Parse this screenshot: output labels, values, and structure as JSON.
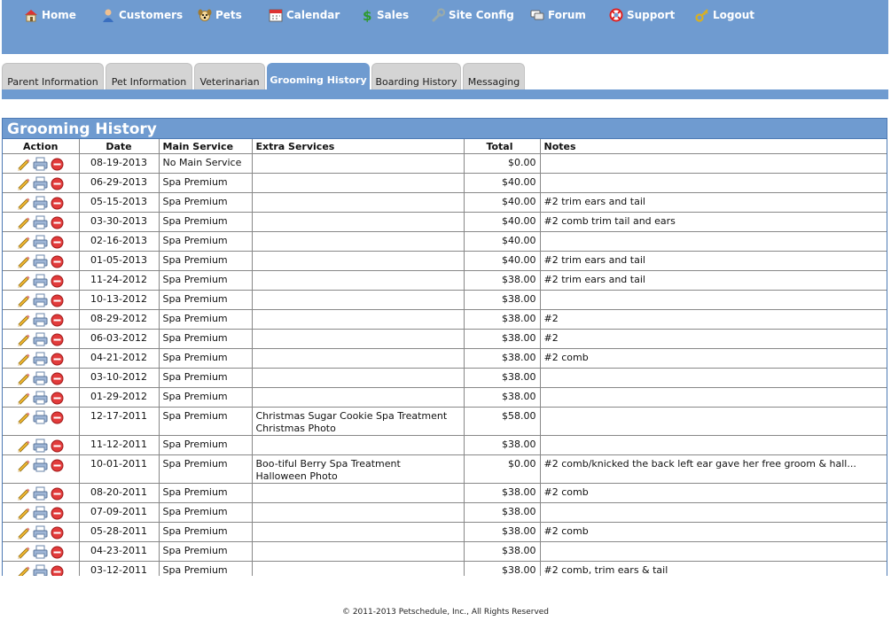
{
  "colors": {
    "brand_blue": "#6f9bd0",
    "tab_gray": "#d4d4d4",
    "panel_border": "#4d7ab5"
  },
  "nav": [
    {
      "label": "Home",
      "icon": "home-icon"
    },
    {
      "label": "Customers",
      "icon": "person-icon"
    },
    {
      "label": "Pets",
      "icon": "dog-icon"
    },
    {
      "label": "Calendar",
      "icon": "calendar-icon"
    },
    {
      "label": "Sales",
      "icon": "dollar-icon"
    },
    {
      "label": "Site Config",
      "icon": "wrench-icon"
    },
    {
      "label": "Forum",
      "icon": "chat-icon"
    },
    {
      "label": "Support",
      "icon": "lifebuoy-icon"
    },
    {
      "label": "Logout",
      "icon": "key-icon"
    }
  ],
  "tabs": [
    {
      "label": "Parent Information",
      "active": false
    },
    {
      "label": "Pet Information",
      "active": false
    },
    {
      "label": "Veterinarian",
      "active": false
    },
    {
      "label": "Grooming History",
      "active": true
    },
    {
      "label": "Boarding History",
      "active": false
    },
    {
      "label": "Messaging",
      "active": false
    }
  ],
  "panel": {
    "title": "Grooming History",
    "columns": [
      "Action",
      "Date",
      "Main Service",
      "Extra Services",
      "Total",
      "Notes"
    ],
    "row_action_icons": [
      "pencil-icon",
      "printer-icon",
      "delete-icon"
    ],
    "rows": [
      {
        "date": "08-19-2013",
        "main": "No Main Service",
        "extra": [
          "",
          ""
        ],
        "total": "$0.00",
        "notes": ""
      },
      {
        "date": "06-29-2013",
        "main": "Spa Premium",
        "extra": [
          "",
          ""
        ],
        "total": "$40.00",
        "notes": ""
      },
      {
        "date": "05-15-2013",
        "main": "Spa Premium",
        "extra": [
          "",
          ""
        ],
        "total": "$40.00",
        "notes": "#2 trim ears and tail"
      },
      {
        "date": "03-30-2013",
        "main": "Spa Premium",
        "extra": [
          "",
          ""
        ],
        "total": "$40.00",
        "notes": "#2 comb trim tail and ears"
      },
      {
        "date": "02-16-2013",
        "main": "Spa Premium",
        "extra": [
          "",
          ""
        ],
        "total": "$40.00",
        "notes": ""
      },
      {
        "date": "01-05-2013",
        "main": "Spa Premium",
        "extra": [
          "",
          ""
        ],
        "total": "$40.00",
        "notes": "#2 trim ears and tail"
      },
      {
        "date": "11-24-2012",
        "main": "Spa Premium",
        "extra": [
          "",
          ""
        ],
        "total": "$38.00",
        "notes": "#2 trim ears and tail"
      },
      {
        "date": "10-13-2012",
        "main": "Spa Premium",
        "extra": [
          "",
          ""
        ],
        "total": "$38.00",
        "notes": ""
      },
      {
        "date": "08-29-2012",
        "main": "Spa Premium",
        "extra": [
          "",
          ""
        ],
        "total": "$38.00",
        "notes": "#2"
      },
      {
        "date": "06-03-2012",
        "main": "Spa Premium",
        "extra": [
          "",
          ""
        ],
        "total": "$38.00",
        "notes": "#2"
      },
      {
        "date": "04-21-2012",
        "main": "Spa Premium",
        "extra": [
          "",
          ""
        ],
        "total": "$38.00",
        "notes": "#2 comb"
      },
      {
        "date": "03-10-2012",
        "main": "Spa Premium",
        "extra": [
          "",
          ""
        ],
        "total": "$38.00",
        "notes": ""
      },
      {
        "date": "01-29-2012",
        "main": "Spa Premium",
        "extra": [
          "",
          ""
        ],
        "total": "$38.00",
        "notes": ""
      },
      {
        "date": "12-17-2011",
        "main": "Spa Premium",
        "extra": [
          "Christmas Sugar Cookie Spa Treatment",
          "Christmas Photo"
        ],
        "total": "$58.00",
        "notes": ""
      },
      {
        "date": "11-12-2011",
        "main": "Spa Premium",
        "extra": [
          "",
          ""
        ],
        "total": "$38.00",
        "notes": ""
      },
      {
        "date": "10-01-2011",
        "main": "Spa Premium",
        "extra": [
          "Boo-tiful Berry Spa Treatment",
          "Halloween Photo"
        ],
        "total": "$0.00",
        "notes": "#2 comb/knicked the back left ear gave her free groom & hall..."
      },
      {
        "date": "08-20-2011",
        "main": "Spa Premium",
        "extra": [
          "",
          ""
        ],
        "total": "$38.00",
        "notes": "#2 comb"
      },
      {
        "date": "07-09-2011",
        "main": "Spa Premium",
        "extra": [
          "",
          ""
        ],
        "total": "$38.00",
        "notes": ""
      },
      {
        "date": "05-28-2011",
        "main": "Spa Premium",
        "extra": [
          "",
          ""
        ],
        "total": "$38.00",
        "notes": "#2 comb"
      },
      {
        "date": "04-23-2011",
        "main": "Spa Premium",
        "extra": [
          "",
          ""
        ],
        "total": "$38.00",
        "notes": ""
      },
      {
        "date": "03-12-2011",
        "main": "Spa Premium",
        "extra": [
          "",
          ""
        ],
        "total": "$38.00",
        "notes": "#2 comb, trim ears & tail"
      }
    ]
  },
  "footer": "© 2011-2013 Petschedule, Inc., All Rights Reserved"
}
